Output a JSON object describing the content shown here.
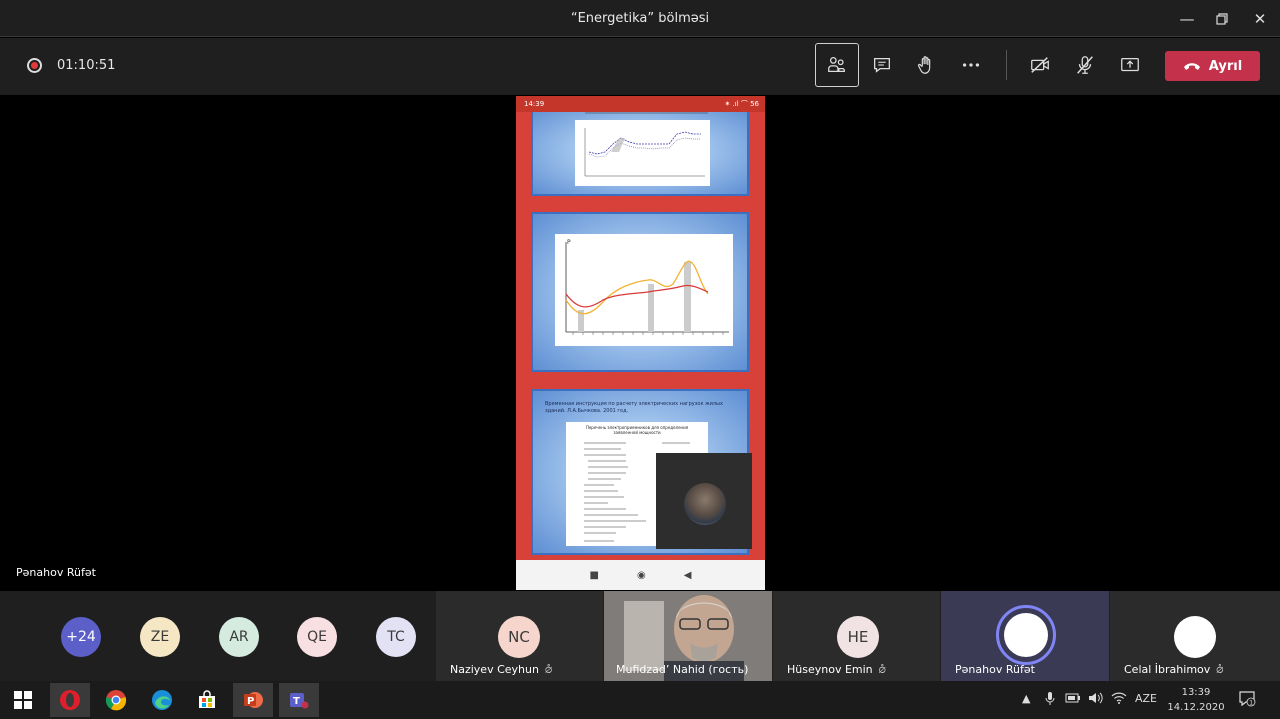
{
  "window": {
    "title": "“Energetika” bölməsi",
    "minimize_icon": "minimize-icon",
    "restore_icon": "restore-icon",
    "close_icon": "close-icon"
  },
  "toolbar": {
    "timer": "01:10:51",
    "leave_label": "Ayrıl",
    "icons": [
      "people-icon",
      "chat-icon",
      "raise-hand-icon",
      "more-icon",
      "camera-off-icon",
      "mic-off-icon",
      "share-screen-icon",
      "phone-hangup-icon"
    ],
    "leave_color": "#c4314b"
  },
  "phone": {
    "time": "14:39",
    "status_right": "✶ .ıl ⌒ 56",
    "slide3_text": "Временная инструкция по расчету электрических нагрузок жилых зданий. Л.А.Бычкова. 2001 год.",
    "slide3_doc_title": "Перечень электроприемников для определения заявленной мощности",
    "nav": [
      "■",
      "◉",
      "◀"
    ]
  },
  "presenter_name": "Pənahov Rüfət",
  "participants": {
    "avatars": [
      {
        "initials": "+24",
        "color": "#5b5fc7",
        "text_color": "#ffffff"
      },
      {
        "initials": "ZE",
        "color": "#f5e6c4",
        "text_color": "#3a3a3a"
      },
      {
        "initials": "AR",
        "color": "#d6ebe0",
        "text_color": "#3a3a3a"
      },
      {
        "initials": "QE",
        "color": "#f8dfe2",
        "text_color": "#3a3a3a"
      },
      {
        "initials": "TC",
        "color": "#e3e2f5",
        "text_color": "#3a3a3a"
      }
    ],
    "tiles": [
      {
        "initials": "NC",
        "name": "Naziyev Ceyhun",
        "color": "#f6d5cd",
        "muted": true
      },
      {
        "initials": "",
        "name": "Mufidzadʼ Nahid (гость)",
        "color": "",
        "muted": false
      },
      {
        "initials": "HE",
        "name": "Hüseynov Emin",
        "color": "#f1e3e3",
        "muted": true
      },
      {
        "initials": "",
        "name": "Pənahov Rüfət",
        "color": "#ffffff",
        "muted": false
      },
      {
        "initials": "",
        "name": "Celal İbrahimov",
        "color": "#ffffff",
        "muted": true
      }
    ]
  },
  "taskbar": {
    "apps": [
      "windows-start-icon",
      "opera-icon",
      "chrome-icon",
      "edge-icon",
      "store-icon",
      "powerpoint-icon",
      "teams-icon"
    ],
    "language": "AZE",
    "time": "13:39",
    "date": "14.12.2020",
    "notifications": "1"
  }
}
